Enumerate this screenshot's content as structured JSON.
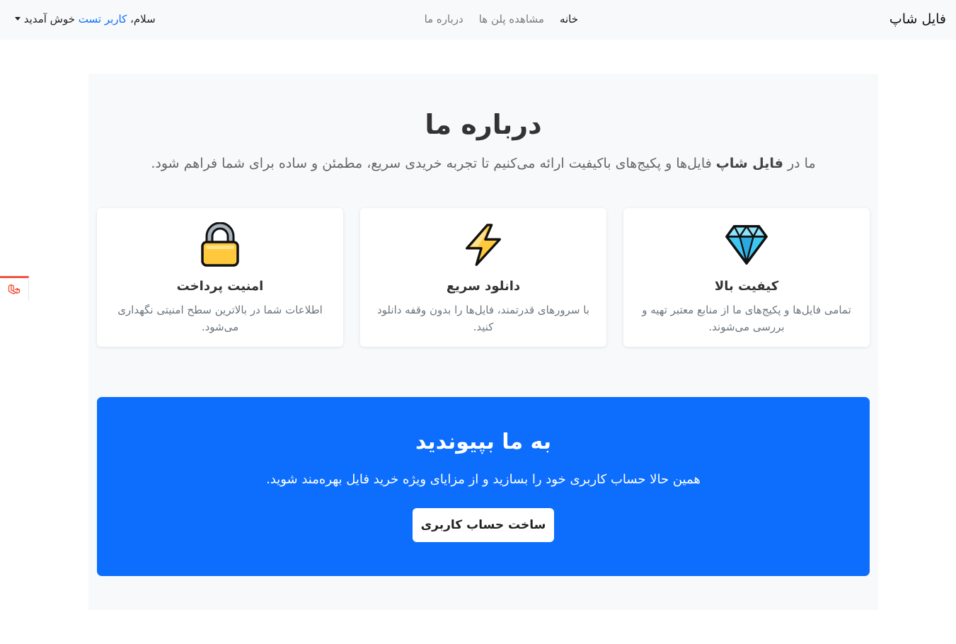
{
  "navbar": {
    "brand": "فایل شاپ",
    "links": [
      {
        "label": "خانه",
        "active": true
      },
      {
        "label": "مشاهده پلن ها",
        "active": false
      },
      {
        "label": "درباره ما",
        "active": false
      }
    ],
    "user": {
      "greeting_prefix": "سلام،",
      "name": "کاربر تست",
      "greeting_suffix": "خوش آمدید"
    }
  },
  "about": {
    "title": "درباره ما",
    "subtitle_prefix": "ما در",
    "subtitle_brand": "فایل شاپ",
    "subtitle_rest": "فایل‌ها و پکیج‌های باکیفیت ارائه می‌کنیم تا تجربه خریدی سریع، مطمئن و ساده برای شما فراهم شود."
  },
  "features": [
    {
      "icon": "diamond-icon",
      "title": "کیفیت بالا",
      "text": "تمامی فایل‌ها و پکیج‌های ما از منابع معتبر تهیه و بررسی می‌شوند."
    },
    {
      "icon": "lightning-icon",
      "title": "دانلود سریع",
      "text": "با سرورهای قدرتمند، فایل‌ها را بدون وقفه دانلود کنید."
    },
    {
      "icon": "lock-icon",
      "title": "امنیت پرداخت",
      "text": "اطلاعات شما در بالاترین سطح امنیتی نگهداری می‌شود."
    }
  ],
  "cta": {
    "title": "به ما بپیوندید",
    "text": "همین حالا حساب کاربری خود را بسازید و از مزایای ویژه خرید فایل بهره‌مند شوید.",
    "button_label": "ساخت حساب کاربری"
  },
  "colors": {
    "primary": "#0d6efd",
    "navbar_bg": "#f8f9fa",
    "section_bg": "#f8f9fa",
    "widget_accent": "#f0533f"
  }
}
